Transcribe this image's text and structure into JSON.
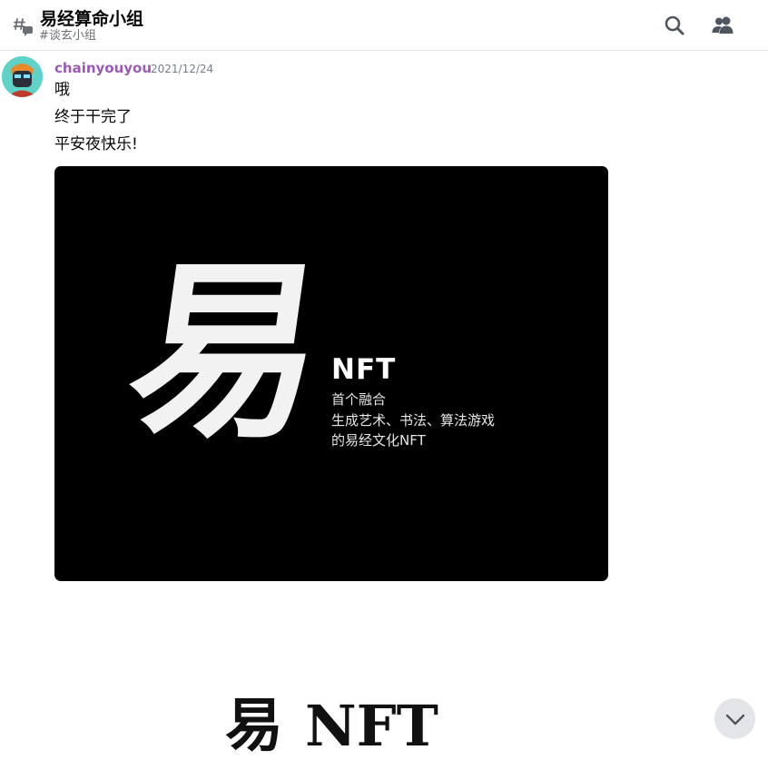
{
  "header": {
    "channel_icon": "threads-hash-icon",
    "title": "易经算命小组",
    "subtitle": "#谈玄小组",
    "search_icon": "search-icon",
    "members_icon": "members-icon"
  },
  "message": {
    "author": "chainyouyou",
    "author_color": "#9b59b6",
    "timestamp": "2021/12/24",
    "lines": [
      "哦",
      "终于干完了",
      "平安夜快乐!"
    ],
    "attachment": {
      "big_char": "易",
      "title": "NFT",
      "lines": [
        "首个融合",
        "生成艺术、书法、算法游戏",
        "的易经文化NFT"
      ]
    }
  },
  "next_preview": {
    "char": "易",
    "text": "NFT"
  },
  "scroll_button_icon": "chevron-down-icon"
}
